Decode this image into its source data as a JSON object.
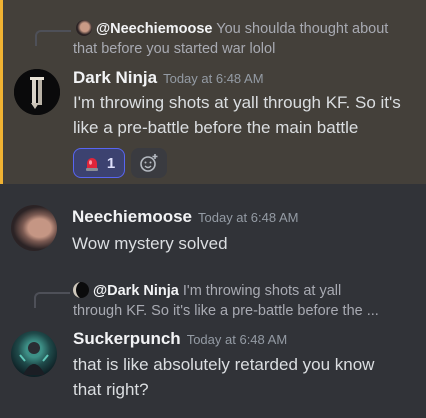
{
  "colors": {
    "background": "#313338",
    "highlight_bg": "#44403a",
    "highlight_bar": "#f0b232",
    "reaction_accent": "#5865f2"
  },
  "messages": [
    {
      "reply": {
        "author": "@Neechiemoose",
        "line1": "You shoulda thought about",
        "line2": "that before you started war lolol"
      },
      "username": "Dark Ninja",
      "timestamp": "Today at 6:48 AM",
      "text_line1": "I'm throwing shots at yall through KF. So it's",
      "text_line2": "like a pre-battle before the main battle",
      "reactions": [
        {
          "icon": "siren-emoji-icon",
          "count": "1"
        },
        {
          "icon": "add-reaction-icon"
        }
      ]
    },
    {
      "username": "Neechiemoose",
      "timestamp": "Today at 6:48 AM",
      "text_line1": "Wow mystery solved"
    },
    {
      "reply": {
        "author": "@Dark Ninja",
        "line1": "I'm throwing shots at yall",
        "line2": "through KF. So it's like a pre-battle before the ..."
      },
      "username": "Suckerpunch",
      "timestamp": "Today at 6:48 AM",
      "text_line1": "that is like absolutely retarded you know",
      "text_line2": "that right?"
    }
  ]
}
